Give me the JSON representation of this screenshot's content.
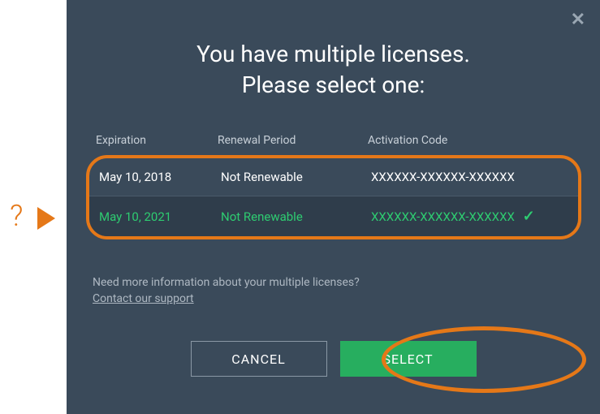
{
  "annotation_question": "?",
  "dialog": {
    "title_line1": "You have multiple licenses.",
    "title_line2": "Please select one:",
    "table": {
      "headers": {
        "expiration": "Expiration",
        "renewal": "Renewal Period",
        "activation": "Activation Code"
      },
      "rows": [
        {
          "expiration": "May 10, 2018",
          "renewal": "Not Renewable",
          "activation": "XXXXXX-XXXXXX-XXXXXX",
          "selected": false
        },
        {
          "expiration": "May 10, 2021",
          "renewal": "Not Renewable",
          "activation": "XXXXXX-XXXXXX-XXXXXX",
          "selected": true
        }
      ]
    },
    "help_text": "Need more information about your multiple licenses?",
    "support_link": "Contact our support",
    "buttons": {
      "cancel": "CANCEL",
      "select": "SELECT"
    }
  },
  "colors": {
    "dialog_bg": "#3a4a5a",
    "accent_orange": "#e57818",
    "accent_green": "#27ae5f",
    "selected_green": "#2ecc71"
  }
}
